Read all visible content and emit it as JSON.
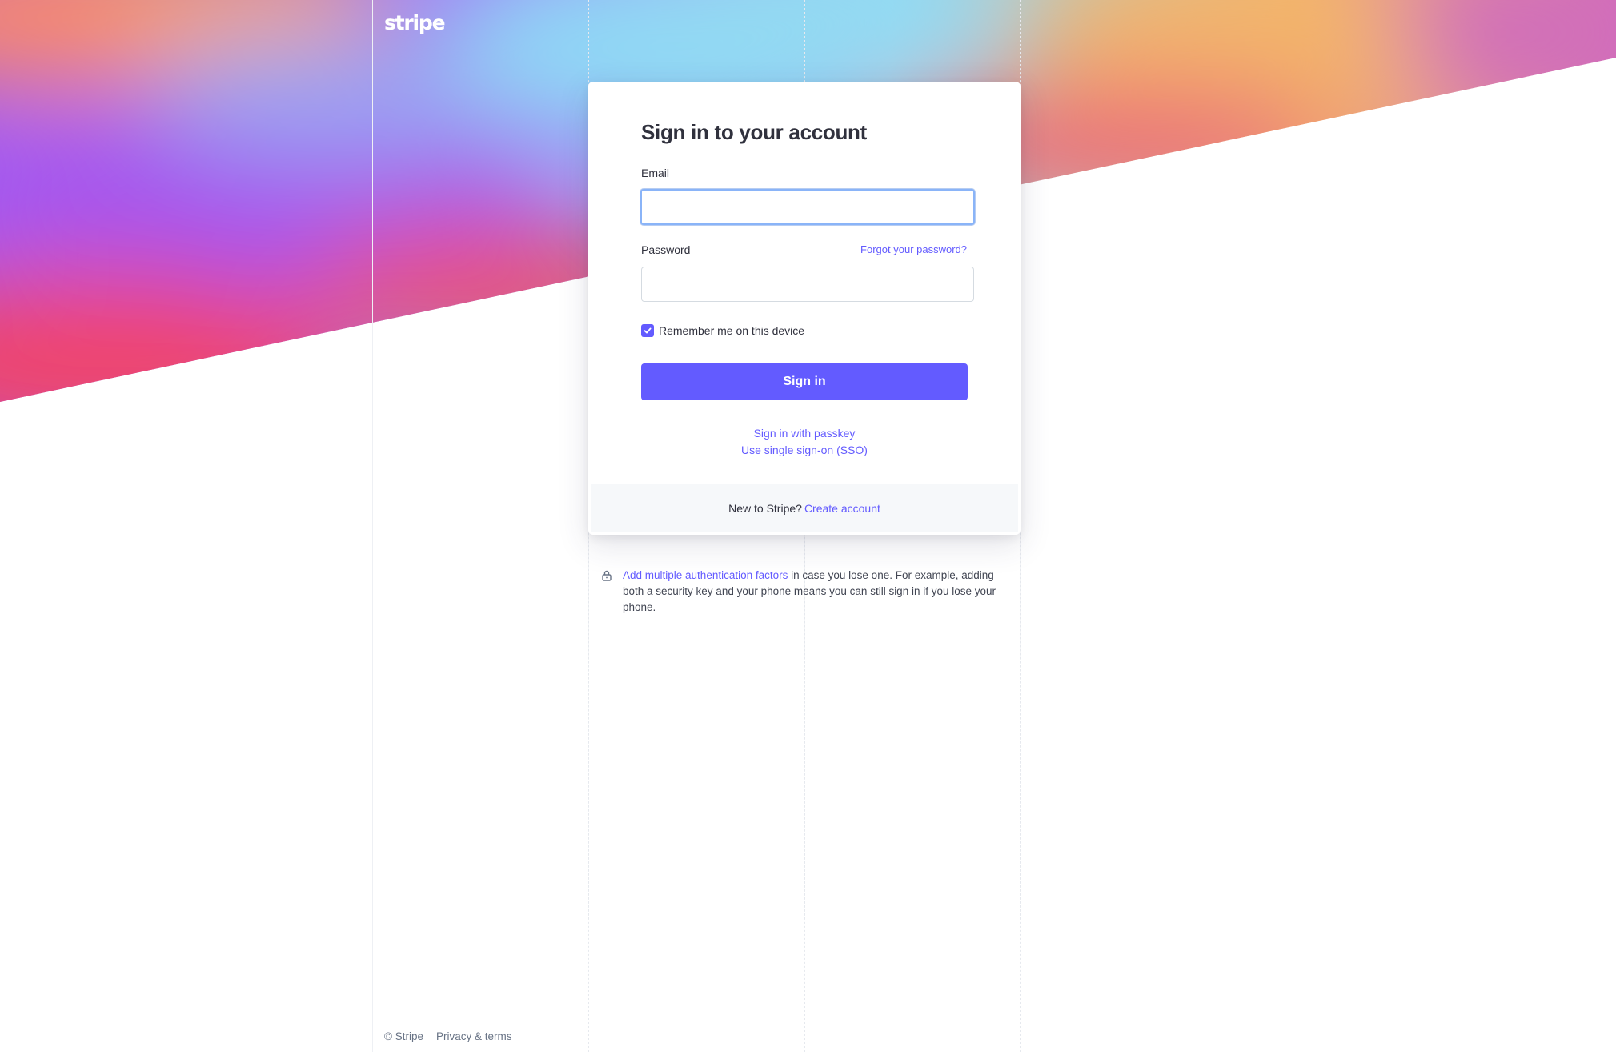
{
  "brand": {
    "logo_text": "stripe"
  },
  "card": {
    "title": "Sign in to your account",
    "email_label": "Email",
    "email_value": "",
    "password_label": "Password",
    "password_value": "",
    "forgot_password": "Forgot your password?",
    "remember_label": "Remember me on this device",
    "remember_checked": true,
    "signin_button": "Sign in",
    "passkey_link": "Sign in with passkey",
    "sso_link": "Use single sign-on (SSO)",
    "footer_prefix": "New to Stripe?",
    "footer_link": "Create account"
  },
  "info": {
    "link_text": "Add multiple authentication factors",
    "text": " in case you lose one. For example, adding both a security key and your phone means you can still sign in if you lose your phone."
  },
  "footer": {
    "copyright": "© Stripe",
    "privacy": "Privacy & terms"
  },
  "colors": {
    "accent": "#635bff",
    "focus_ring": "#8ab4f8",
    "footer_bg": "#f6f8fa",
    "text": "#30313d"
  },
  "icons": {
    "lock": "lock-icon",
    "checkbox": "checkmark-icon"
  }
}
